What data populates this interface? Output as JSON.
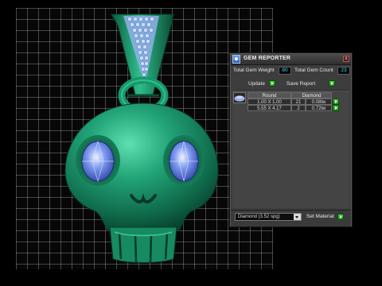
{
  "panel": {
    "title": "GEM REPORTER",
    "app_icon": "gem-reporter-icon",
    "close_label": "x",
    "total_weight_label": "Total Gem Weight",
    "total_weight_value": "80",
    "total_count_label": "Total Gem Count",
    "total_count_value": "23",
    "update_label": "Update",
    "save_report_label": "Save Report"
  },
  "gem_table": {
    "shape": "Round",
    "material": "Diamond",
    "rows": [
      {
        "size": "1.00 X 1.00",
        "count": "21",
        "weight": "0.08tw"
      },
      {
        "size": "5.55 X 4.17",
        "count": "2",
        "weight": "0.72tw"
      }
    ]
  },
  "material_select": {
    "selected": "Diamond   (3.52 spg)"
  },
  "set_material_label": "Set Material",
  "colors": {
    "metal": "#1f8a62",
    "gem": "#6b88e6",
    "accent_value": "#3ad3e6",
    "go_button": "#3cb82c"
  }
}
